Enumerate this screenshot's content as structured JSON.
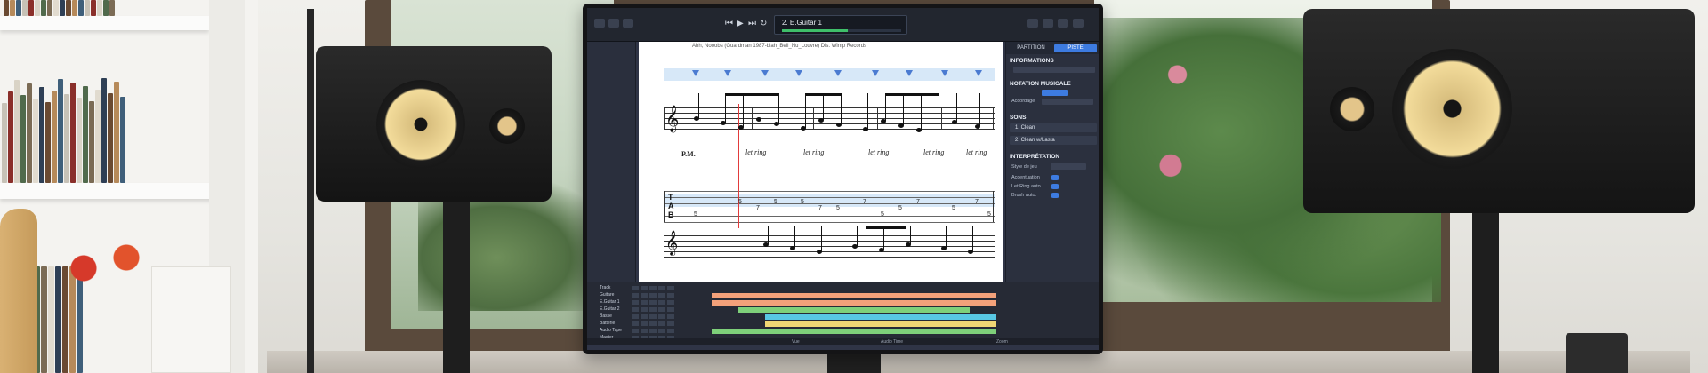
{
  "scene": "home-music-studio",
  "app": {
    "track_name": "2. E.Guitar 1",
    "track_progress": 0.55,
    "score_title": "Ahh, Nooobs (Guardman 1987-blah_Bell_Nu_Louvre) Dis. Wimp Records",
    "inspector": {
      "tab_partition": "PARTITION",
      "tab_piste": "PISTE",
      "informations": "INFORMATIONS",
      "notation_musicale": "NOTATION MUSICALE",
      "accordage": "Accordage",
      "sons": "SONS",
      "sound_1": "1. Clean",
      "sound_2": "2. Clean w/Lasta",
      "interpretation": "INTERPRÉTATION",
      "style_de_jeu": "Style de jeu",
      "let_ring": "Let Ring auto.",
      "brush_auto": "Brush auto.",
      "auto_slide": "Accentuation"
    },
    "score": {
      "pm": "P.M.",
      "let_ring_labels": [
        "let ring",
        "let ring",
        "let ring",
        "let ring",
        "let ring"
      ],
      "tab_letters": [
        "T",
        "A",
        "B"
      ],
      "tab_numbers": [
        "5",
        "5",
        "7",
        "5",
        "5",
        "7",
        "5",
        "7",
        "5",
        "5",
        "7",
        "5",
        "7",
        "5"
      ]
    },
    "tracks": [
      "Track",
      "Guitare",
      "E.Guitar 1",
      "E.Guitar 2",
      "Basse",
      "Batterie",
      "Audio Tape",
      "Master"
    ],
    "bottom_labels": [
      "Vue",
      "Audio Time",
      "Zoom"
    ]
  },
  "colors": {
    "progress_green": "#3fbf6a",
    "selection_blue": "#3d7be0",
    "cursor_red": "#e23b3b",
    "seq_orange": "#f3a17a",
    "seq_green": "#7ed07a",
    "seq_cyan": "#58c7e3",
    "seq_yellow": "#f0d774"
  }
}
